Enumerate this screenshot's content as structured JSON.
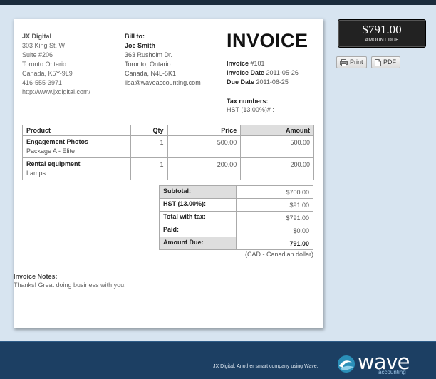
{
  "from": {
    "company": "JX Digital",
    "address1": "303 King St. W",
    "address2": "Suite #206",
    "city": "Toronto Ontario",
    "country_postal": "Canada, K5Y-9L9",
    "phone": "416-555-3971",
    "website": "http://www.jxdigital.com/"
  },
  "bill_to": {
    "label": "Bill to:",
    "name": "Joe Smith",
    "address": "363 Rusholm Dr.",
    "city": "Toronto, Ontario",
    "country_postal": "Canada, N4L-5K1",
    "email": "lisa@waveaccounting.com"
  },
  "invoice": {
    "title": "INVOICE",
    "number_label": "Invoice",
    "number": "#101",
    "date_label": "Invoice Date",
    "date": "2011-05-26",
    "due_label": "Due Date",
    "due": "2011-06-25",
    "tax_label": "Tax numbers:",
    "tax_value": "HST (13.00%)# :"
  },
  "items": {
    "headers": [
      "Product",
      "Qty",
      "Price",
      "Amount"
    ],
    "rows": [
      {
        "name": "Engagement Photos",
        "desc": "Package A - Elite",
        "qty": "1",
        "price": "500.00",
        "amount": "500.00"
      },
      {
        "name": "Rental equipment",
        "desc": "Lamps",
        "qty": "1",
        "price": "200.00",
        "amount": "200.00"
      }
    ]
  },
  "totals": {
    "subtotal_label": "Subtotal:",
    "subtotal": "$700.00",
    "tax_label": "HST (13.00%):",
    "tax": "$91.00",
    "with_tax_label": "Total with tax:",
    "with_tax": "$791.00",
    "paid_label": "Paid:",
    "paid": "$0.00",
    "due_label": "Amount Due:",
    "due": "791.00",
    "currency": "(CAD - Canadian dollar)"
  },
  "notes": {
    "label": "Invoice Notes:",
    "text": "Thanks! Great doing business with you."
  },
  "sidebar": {
    "amount": "$791.00",
    "amount_label": "AMOUNT DUE",
    "print_label": "Print",
    "pdf_label": "PDF"
  },
  "footer": {
    "tagline": "JX Digital: Another smart company using Wave.",
    "logo_word": "wave",
    "logo_sub": "accounting"
  },
  "colors": {
    "background": "#d7e4f0",
    "footer": "#1c3f63",
    "amount_box": "#222222"
  }
}
